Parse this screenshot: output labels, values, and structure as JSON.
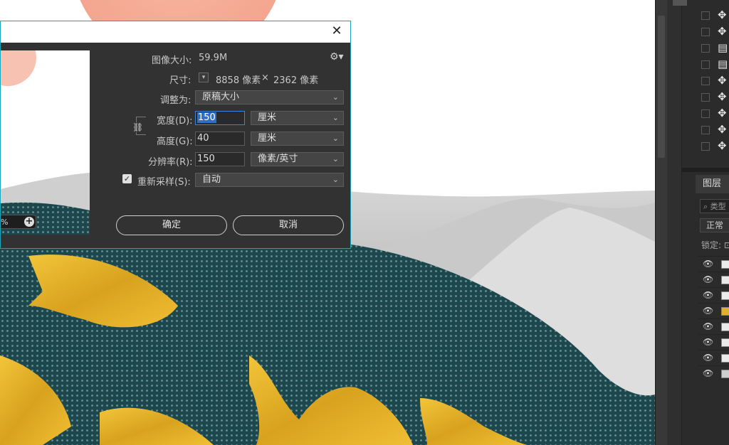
{
  "dialog": {
    "image_size_label": "图像大小:",
    "image_size_value": "59.9M",
    "dimensions_label": "尺寸:",
    "dimensions_width": "8858 像素",
    "dimensions_sep": "×",
    "dimensions_height": "2362 像素",
    "fit_to_label": "调整为:",
    "fit_to_value": "原稿大小",
    "width_label": "宽度(D):",
    "width_value": "150",
    "width_unit": "厘米",
    "height_label": "高度(G):",
    "height_value": "40",
    "height_unit": "厘米",
    "resolution_label": "分辨率(R):",
    "resolution_value": "150",
    "resolution_unit": "像素/英寸",
    "resample_label": "重新采样(S):",
    "resample_value": "自动",
    "ok_label": "确定",
    "cancel_label": "取消",
    "zoom_value": "%",
    "resample_checked": true
  },
  "layers_panel": {
    "tab_label": "图层",
    "filter_placeholder": "⌕ 类型",
    "blend_mode": "正常",
    "lock_label": "锁定: ⊡"
  },
  "colors": {
    "dialog_border": "#1aa6b7",
    "focus_blue": "#3d84d6",
    "wave_teal": "#1f4a4f",
    "fish_gold": "#e2b128"
  }
}
